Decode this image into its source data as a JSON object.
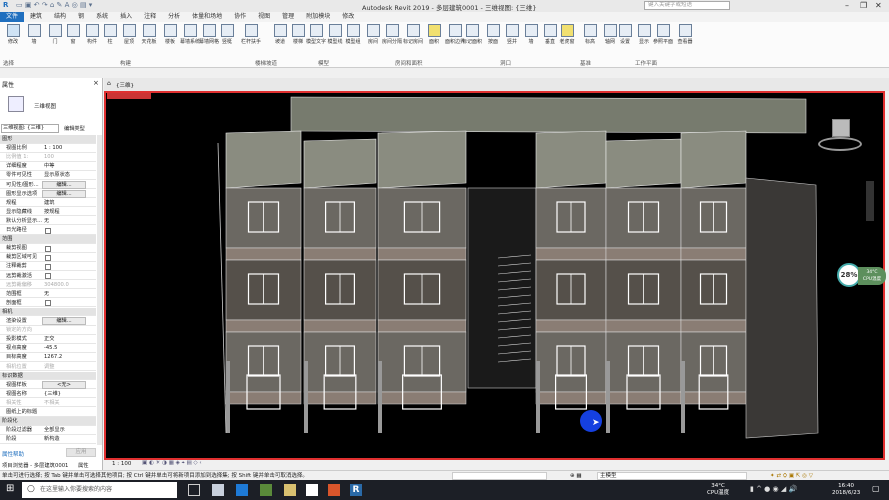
{
  "title": "Autodesk Revit 2019 - 多层建筑0001 - 三维视图: {三维}",
  "search_placeholder": "键入关键字或短语",
  "ribbon_tabs": [
    "文件",
    "建筑",
    "结构",
    "钢",
    "系统",
    "插入",
    "注释",
    "分析",
    "体量和场地",
    "协作",
    "视图",
    "管理",
    "附加模块",
    "修改"
  ],
  "ribbon_buttons": [
    "修改",
    "墙",
    "门",
    "窗",
    "构件",
    "柱",
    "屋顶",
    "天花板",
    "楼板",
    "幕墙系统",
    "幕墙网格",
    "竖梃",
    "栏杆扶手",
    "坡道",
    "楼梯",
    "模型文字",
    "模型线",
    "模型组",
    "房间",
    "房间分隔",
    "标记房间",
    "面积",
    "面积边界",
    "标记面积",
    "按面",
    "竖井",
    "墙",
    "垂直",
    "老虎窗",
    "标高",
    "轴网",
    "设置",
    "显示",
    "参照平面",
    "查看器"
  ],
  "ribbon_panels": [
    "选择",
    "构建",
    "楼梯坡道",
    "模型",
    "房间和面积",
    "洞口",
    "基准",
    "工作平面"
  ],
  "properties": {
    "title": "属性",
    "type_name": "三维视图",
    "selector": "三维视图: {三维}",
    "edit_type": "编辑类型",
    "rows": [
      {
        "sec": "图形"
      },
      {
        "k": "视图比例",
        "v": "1 : 100"
      },
      {
        "k": "比例值 1:",
        "v": "100",
        "dim": true
      },
      {
        "k": "详细程度",
        "v": "中等"
      },
      {
        "k": "零件可见性",
        "v": "显示原状态"
      },
      {
        "k": "可见性/图形...",
        "btn": "编辑..."
      },
      {
        "k": "图形显示选项",
        "btn": "编辑..."
      },
      {
        "k": "规程",
        "v": "建筑"
      },
      {
        "k": "显示隐藏线",
        "v": "按规程"
      },
      {
        "k": "默认分析显示...",
        "v": "无"
      },
      {
        "k": "日光路径",
        "cb": true
      },
      {
        "sec": "范围"
      },
      {
        "k": "裁剪视图",
        "cb": true
      },
      {
        "k": "裁剪区域可见",
        "cb": true
      },
      {
        "k": "注释裁剪",
        "cb": true
      },
      {
        "k": "远剪裁激活",
        "cb": true
      },
      {
        "k": "远剪裁偏移",
        "v": "304800.0",
        "dim": true
      },
      {
        "k": "范围框",
        "v": "无"
      },
      {
        "k": "剖面框",
        "cb": true
      },
      {
        "sec": "相机"
      },
      {
        "k": "渲染设置",
        "btn": "编辑..."
      },
      {
        "k": "锁定的方向",
        "dim": true
      },
      {
        "k": "投影模式",
        "v": "正交"
      },
      {
        "k": "视点高度",
        "v": "-45.5"
      },
      {
        "k": "目标高度",
        "v": "1267.2"
      },
      {
        "k": "相机位置",
        "v": "调整",
        "dim": true
      },
      {
        "sec": "标识数据"
      },
      {
        "k": "视图样板",
        "btn": "<无>"
      },
      {
        "k": "视图名称",
        "v": "{三维}"
      },
      {
        "k": "相关性",
        "v": "不相关",
        "dim": true
      },
      {
        "k": "图纸上的标题"
      },
      {
        "sec": "阶段化"
      },
      {
        "k": "阶段过滤器",
        "v": "全部显示"
      },
      {
        "k": "阶段",
        "v": "新构造"
      }
    ],
    "help": "属性帮助",
    "apply": "应用"
  },
  "bottom_tabs": [
    "项目浏览器 - 多层建筑0001",
    "属性"
  ],
  "view_tab": "{三维}",
  "view_scale": "1 : 100",
  "workset": "主模型",
  "overlay": {
    "cpu_percent": "28%",
    "temp": "34°C",
    "temp_label": "CPU温度"
  },
  "status": "单击可进行选择; 按 Tab 键并单击可选择其他项目; 按 Ctrl 键并单击可将新项目添加到选择集; 按 Shift 键并单击可取消选择。",
  "taskbar": {
    "search": "在这里输入你要搜索的内容",
    "temp": "34°C",
    "temp_label": "CPU温度",
    "time": "16:40",
    "date": "2018/6/23"
  }
}
